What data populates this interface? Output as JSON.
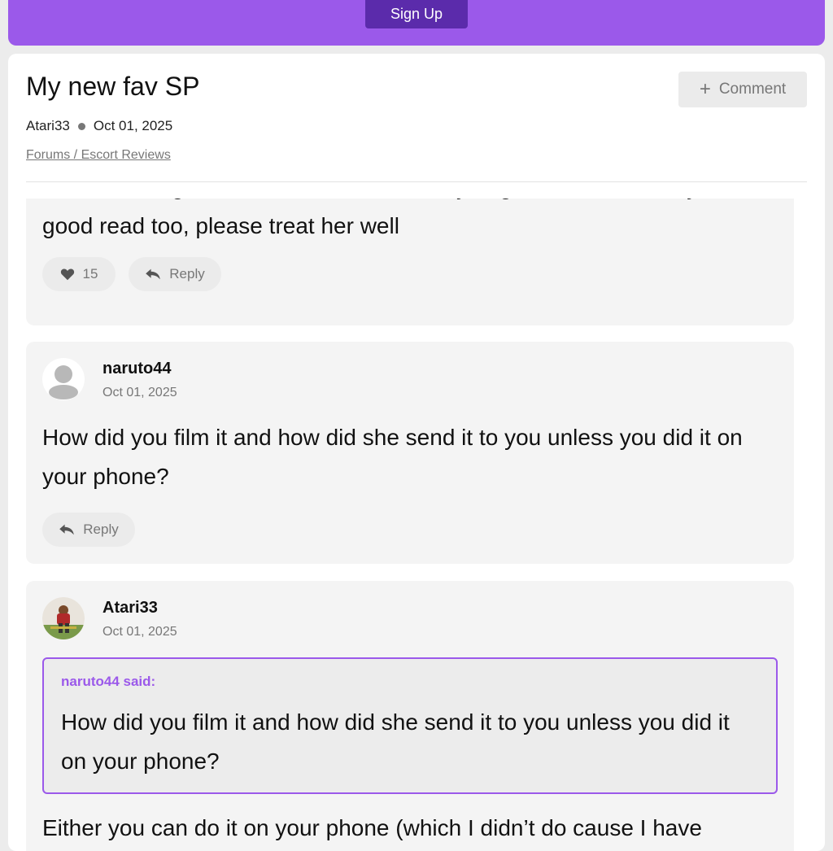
{
  "header": {
    "signup_label": "Sign Up"
  },
  "thread": {
    "title": "My new fav SP",
    "author": "Atari33",
    "date": "Oct 01, 2025",
    "breadcrumb": "Forums / Escort Reviews",
    "comment_label": "Comment"
  },
  "posts": [
    {
      "text_partial_top": "have to indulge to see :D Her ebook that you get as well is a very",
      "text_bottom": "good read too, please treat her well",
      "likes": "15",
      "reply_label": "Reply"
    },
    {
      "username": "naruto44",
      "date": "Oct 01, 2025",
      "text": "How did you film it and how did she send it to you unless you did it on your phone?",
      "reply_label": "Reply"
    },
    {
      "username": "Atari33",
      "date": "Oct 01, 2025",
      "quote_author": "naruto44 said:",
      "quote_text": "How did you film it and how did she send it to you unless you did it on your phone?",
      "text": "Either you can do it on your phone (which I didn’t do cause I have"
    }
  ],
  "colors": {
    "accent": "#9b59ea",
    "button_dark": "#5b2bab",
    "post_bg": "#f4f4f4"
  },
  "icons": [
    "plus-icon",
    "heart-icon",
    "reply-arrow-icon",
    "default-avatar-icon",
    "user-photo-avatar"
  ]
}
